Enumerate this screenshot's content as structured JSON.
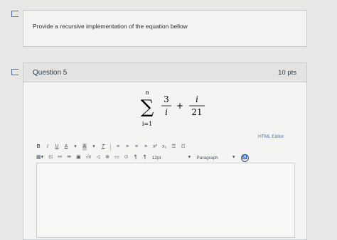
{
  "question4": {
    "text": "Provide a recursive implementation of the equation bellow"
  },
  "question5": {
    "title": "Question 5",
    "points": "10 pts",
    "equation": {
      "sum_upper": "n",
      "sum_lower": "i=1",
      "term1_num": "3",
      "term1_den": "i",
      "plus": "+",
      "term2_num": "i",
      "term2_den": "21"
    }
  },
  "editor": {
    "html_editor_link": "HTML Editor",
    "toolbar_row1": [
      "B",
      "I",
      "U",
      "A",
      "▾",
      "A",
      "▾",
      "T",
      "≡",
      "≡",
      "≡",
      "≡",
      "x²",
      "x₂",
      "☰",
      "☷"
    ],
    "font_size": "12pt",
    "paragraph": "Paragraph"
  }
}
